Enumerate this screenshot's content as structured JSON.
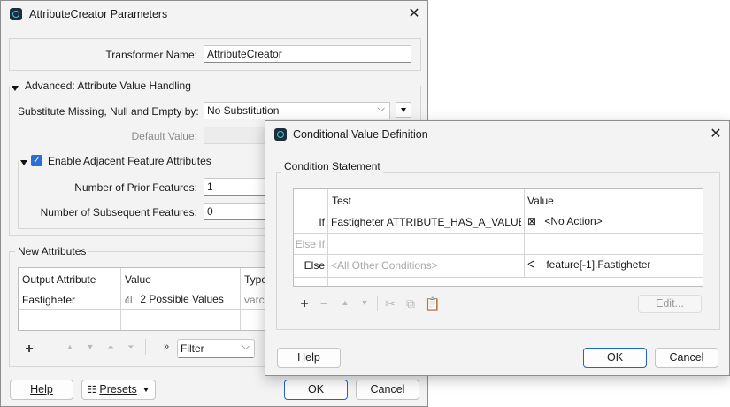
{
  "main_dialog": {
    "title": "AttributeCreator Parameters",
    "transformer_name_label": "Transformer Name:",
    "transformer_name_value": "AttributeCreator",
    "advanced_section_label": "Advanced: Attribute Value Handling",
    "substitute_label": "Substitute Missing, Null and Empty by:",
    "substitute_value": "No Substitution",
    "default_value_label": "Default Value:",
    "enable_adjacent_label": "Enable Adjacent Feature Attributes",
    "enable_adjacent_checked": true,
    "prior_features_label": "Number of Prior Features:",
    "prior_features_value": "1",
    "subsequent_features_label": "Number of Subsequent Features:",
    "subsequent_features_value": "0",
    "new_attributes_label": "New Attributes",
    "columns": [
      "Output Attribute",
      "Value",
      "Type"
    ],
    "rows": [
      {
        "output_attribute": "Fastigheter",
        "value": "2 Possible Values",
        "type": "varch"
      }
    ],
    "filter_value": "Filter",
    "help_label": "Help",
    "presets_label": "Presets",
    "ok_label": "OK",
    "cancel_label": "Cancel"
  },
  "conditional_dialog": {
    "title": "Conditional Value Definition",
    "condition_statement_label": "Condition Statement",
    "columns": [
      "Test",
      "Value"
    ],
    "rows": [
      {
        "keyword": "If",
        "test": "Fastigheter ATTRIBUTE_HAS_A_VALUE",
        "value": "<No Action>",
        "value_icon": "no-action-icon"
      },
      {
        "keyword": "Else If",
        "test": "",
        "value": "",
        "value_icon": ""
      },
      {
        "keyword": "Else",
        "test": "<All Other Conditions>",
        "value": "feature[-1].Fastigheter",
        "value_icon": "attribute-value-icon"
      }
    ],
    "edit_label": "Edit...",
    "help_label": "Help",
    "ok_label": "OK",
    "cancel_label": "Cancel"
  },
  "colors": {
    "accent": "#1a66c5",
    "checkbox": "#2a6fd6",
    "window_bg": "#f3f3f3"
  }
}
